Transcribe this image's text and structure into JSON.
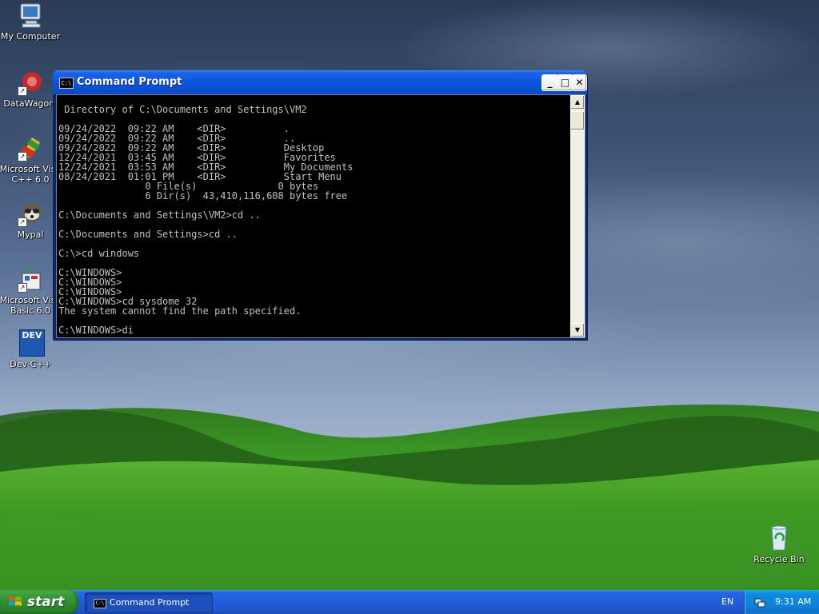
{
  "desktop": {
    "icons": [
      {
        "label": "My Computer"
      },
      {
        "label": "DataWagon."
      },
      {
        "label": "Microsoft Visu",
        "label2": "C++ 6.0"
      },
      {
        "label": "Mypal"
      },
      {
        "label": "Microsoft Visu",
        "label2": "Basic 6.0"
      },
      {
        "label": "Dev-C++",
        "badge": "DEV"
      },
      {
        "label": "Recycle Bin"
      }
    ]
  },
  "window": {
    "title": "Command Prompt",
    "icon_text": "C:\\",
    "min_glyph": "_",
    "max_glyph": "□",
    "close_glyph": "✕",
    "console_lines": [
      "",
      " Directory of C:\\Documents and Settings\\VM2",
      "",
      "09/24/2022  09:22 AM    <DIR>          .",
      "09/24/2022  09:22 AM    <DIR>          ..",
      "09/24/2022  09:22 AM    <DIR>          Desktop",
      "12/24/2021  03:45 AM    <DIR>          Favorites",
      "12/24/2021  03:53 AM    <DIR>          My Documents",
      "08/24/2021  01:01 PM    <DIR>          Start Menu",
      "               0 File(s)              0 bytes",
      "               6 Dir(s)  43,410,116,608 bytes free",
      "",
      "C:\\Documents and Settings\\VM2>cd ..",
      "",
      "C:\\Documents and Settings>cd ..",
      "",
      "C:\\>cd windows",
      "",
      "C:\\WINDOWS>",
      "C:\\WINDOWS>",
      "C:\\WINDOWS>",
      "C:\\WINDOWS>cd sysdome 32",
      "The system cannot find the path specified.",
      "",
      "C:\\WINDOWS>di"
    ],
    "scroll_up": "▲",
    "scroll_down": "▼"
  },
  "taskbar": {
    "start_label": "start",
    "tasks": [
      {
        "label": "Command Prompt",
        "icon_text": "C:\\"
      }
    ],
    "language": "EN",
    "clock": "9:31 AM"
  }
}
